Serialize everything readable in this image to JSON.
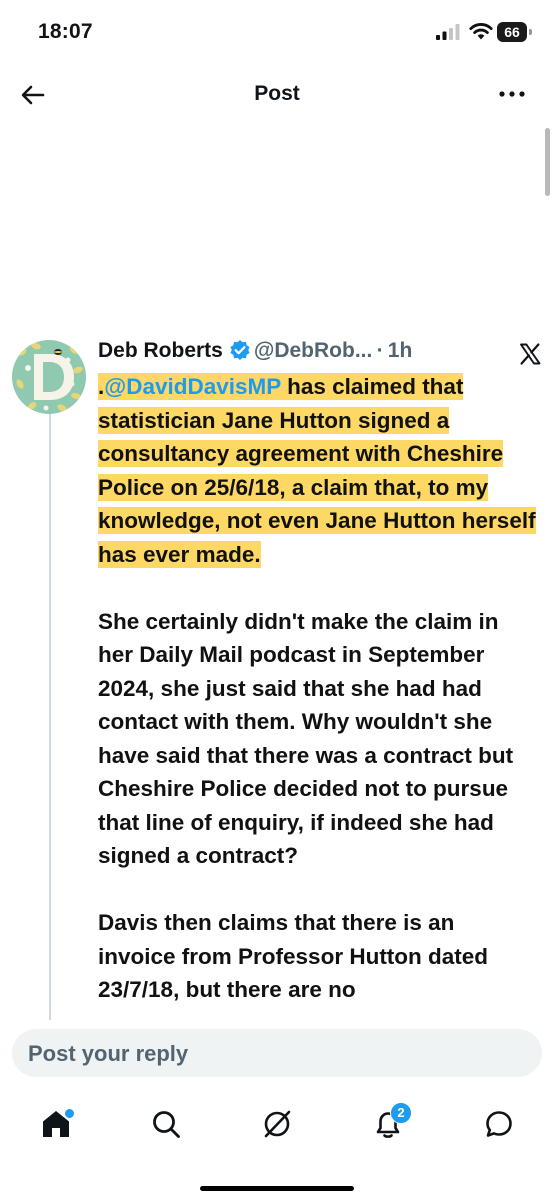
{
  "status_bar": {
    "time": "18:07",
    "battery": "66"
  },
  "header": {
    "title": "Post"
  },
  "post": {
    "author_name": "Deb Roberts",
    "author_handle": "@DebRob...",
    "separator": "·",
    "time": "1h",
    "paragraph1": {
      "prefix": ".",
      "mention": "@DavidDavisMP",
      "text": " has claimed that statistician Jane Hutton signed a consultancy agreement with Cheshire Police on 25/6/18, a claim that, to my knowledge, not even Jane Hutton herself has ever made."
    },
    "paragraph2": "She certainly didn't make the claim in her Daily Mail podcast in September 2024, she just said that she had had contact with them. Why wouldn't she have said that there was a contract but Cheshire Police decided not to pursue that line of enquiry, if indeed she had signed a contract?",
    "paragraph3": "Davis then claims that there is an invoice from Professor Hutton dated 23/7/18, but there are no"
  },
  "reply": {
    "placeholder": "Post your reply"
  },
  "nav": {
    "notification_count": "2"
  },
  "colors": {
    "accent": "#1d9bf0",
    "highlight": "#fccd38"
  }
}
